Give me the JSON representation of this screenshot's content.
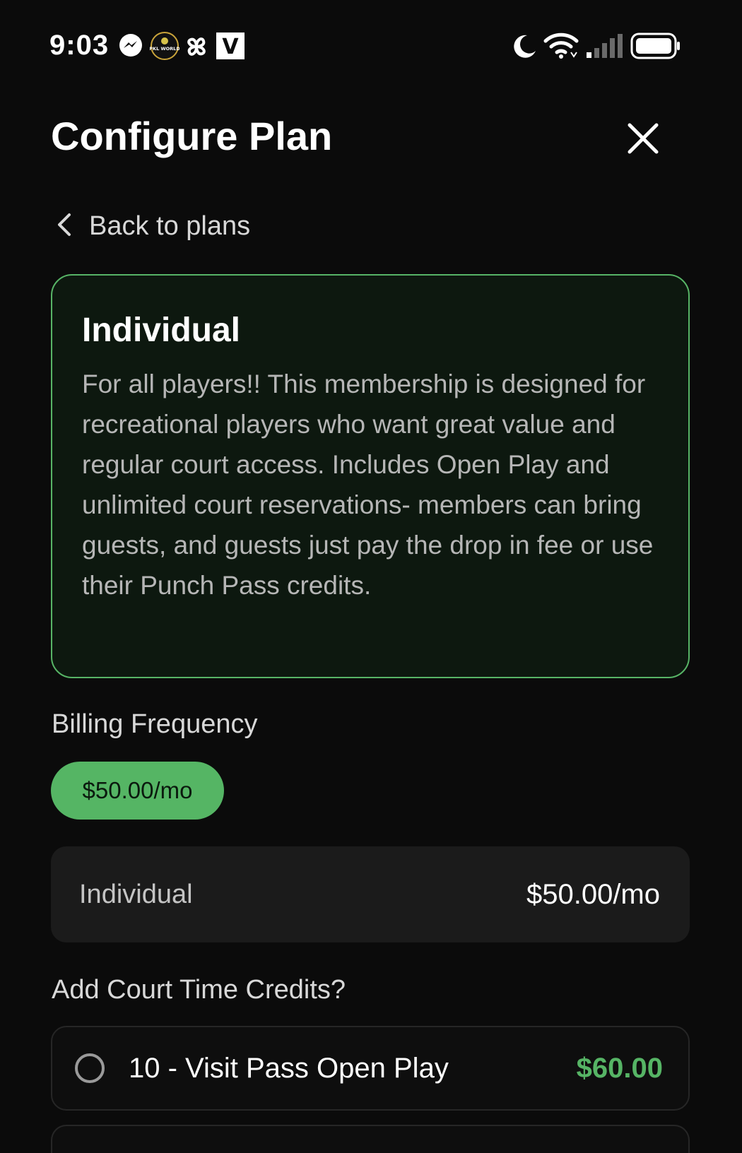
{
  "status_bar": {
    "time": "9:03",
    "notification_icons": [
      "messenger-icon",
      "pkl-world-icon",
      "pinwheel-icon",
      "v-app-icon"
    ],
    "system_icons": [
      "moon-icon",
      "wifi-icon",
      "signal-icon",
      "battery-icon"
    ],
    "pkl_world_text": "PKL WORLD",
    "v_app_letter": "V"
  },
  "header": {
    "title": "Configure Plan",
    "close_icon": "close-icon"
  },
  "back": {
    "label": "Back to plans",
    "icon": "chevron-left-icon"
  },
  "plan": {
    "name": "Individual",
    "description": "For all players!! This membership is designed for recreational players who want great value and regular court access. Includes Open Play and unlimited court reservations- members can bring guests, and guests just pay the drop in fee or use their Punch Pass credits."
  },
  "billing": {
    "label": "Billing Frequency",
    "selected_option": "$50.00/mo"
  },
  "summary": {
    "name": "Individual",
    "price": "$50.00/mo"
  },
  "credits": {
    "label": "Add Court Time Credits?",
    "options": [
      {
        "label": "10 - Visit Pass Open Play",
        "price": "$60.00",
        "selected": false
      }
    ]
  },
  "colors": {
    "accent_green": "#56b465",
    "background": "#0b0b0b",
    "card_background": "#0d180f",
    "row_background": "#1b1b1b"
  }
}
